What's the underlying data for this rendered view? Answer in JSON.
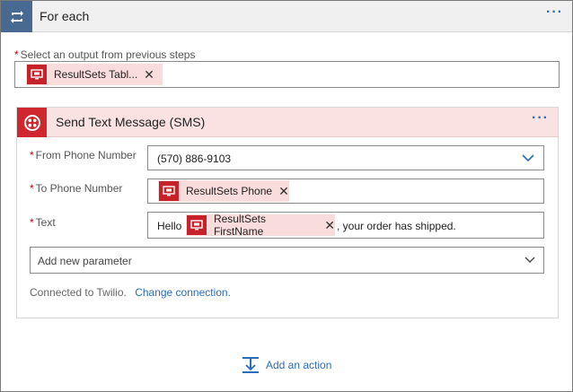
{
  "foreach": {
    "title": "For each",
    "more_label": "···",
    "select_label_req": "*",
    "select_label": "Select an output from previous steps",
    "select_token": "ResultSets Tabl..."
  },
  "sms": {
    "title": "Send Text Message (SMS)",
    "more_label": "···",
    "from_label": "From Phone Number",
    "from_value": "(570) 886-9103",
    "to_label": "To Phone Number",
    "to_token": "ResultSets Phone",
    "text_label": "Text",
    "text_prefix": "Hello",
    "text_token": "ResultSets FirstName",
    "text_suffix": ", your order has shipped.",
    "add_param": "Add new parameter",
    "connected_text": "Connected to Twilio.",
    "change_connection": "Change connection."
  },
  "add_action": "Add an action",
  "colors": {
    "foreach_icon_bg": "#486991",
    "twilio_red": "#cf272d",
    "token_bg": "#f9dcdc",
    "link": "#2a6ebb"
  },
  "icons": {
    "foreach": "loop-icon",
    "twilio": "twilio-logo-icon",
    "token": "sql-monitor-icon",
    "add_action": "add-step-icon"
  }
}
